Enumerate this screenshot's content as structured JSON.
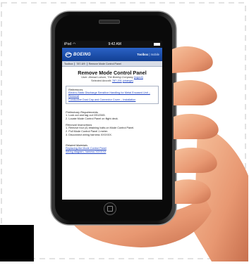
{
  "status": {
    "carrier": "iPod",
    "time": "9:42 AM"
  },
  "app": {
    "logo_text": "BOEING",
    "toolbox": "Toolbox",
    "toolbox_suffix": " | mobile"
  },
  "breadcrumbs": [
    "Toolbox",
    "787-8/9",
    "Remove Mode Control Panel"
  ],
  "page": {
    "title": "Remove Mode Control Panel",
    "user_prefix": "User: ",
    "user_name": "Ahmad Larson, The Boeing Company",
    "logout": "(logout)",
    "aircraft_prefix": "Selected Aircraft: ",
    "aircraft": "787-201",
    "change": "(change)"
  },
  "references": {
    "heading": "References",
    "items": [
      "Electro-Static Discharge Sensitive Handling for Metal Encased Unit – Removal",
      "Conductive Dust Cap and Connector Cover – Installation"
    ]
  },
  "preliminary": {
    "heading": "Preliminary Requirements",
    "items": [
      "1.  Lock out and tag out CB12345.",
      "2.  Locate Mode Control Panel on flight deck."
    ]
  },
  "removal": {
    "heading": "Removal Instructions",
    "items": [
      "1.  Remove four (4) retaining bolts on Mode Control Panel.",
      "2.  Pull Mode Control Panel 1 meter.",
      "3.  Disconnect wiring harness XXXXXX."
    ]
  },
  "related": {
    "heading": "Related Materials",
    "items": [
      "Replacing the Mode Control Panel",
      "Wiring diagram, harness XXXXXX"
    ]
  },
  "colors": {
    "app_bar": "#1c4fae",
    "link": "#1a3fc0",
    "phone_body": "#111111",
    "skin": "#f0a882"
  }
}
